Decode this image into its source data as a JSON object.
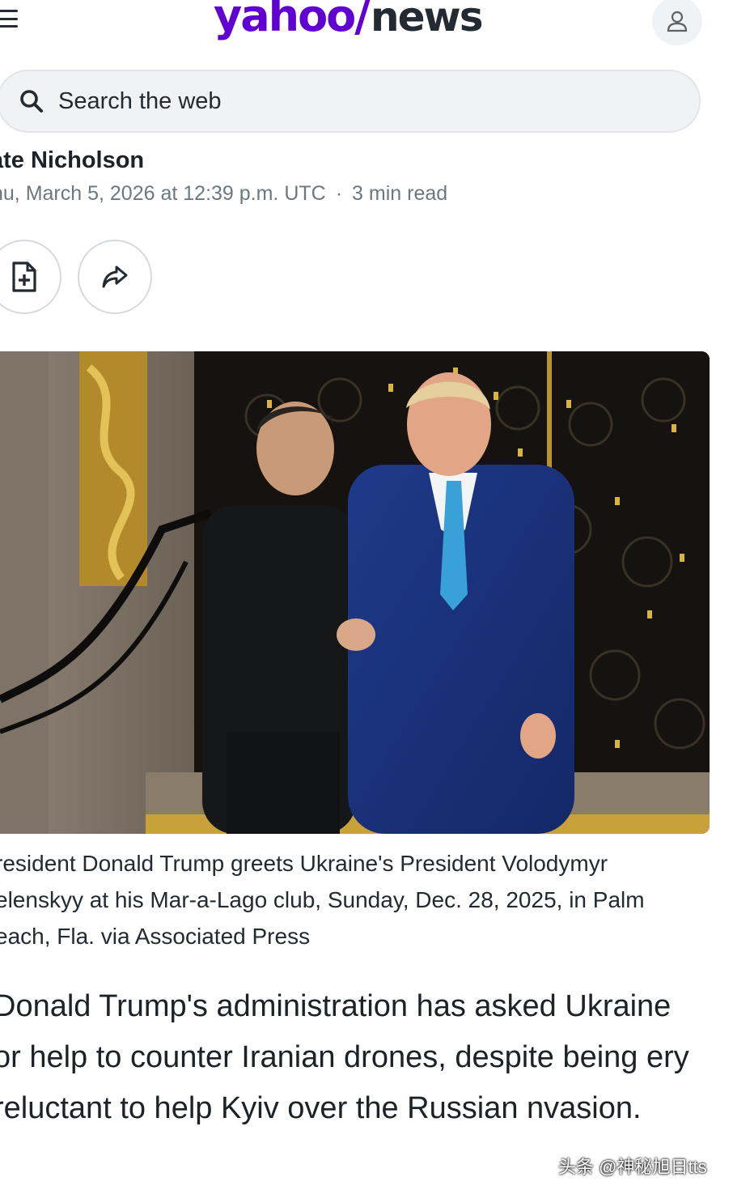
{
  "header": {
    "logo_yahoo": "yahoo/",
    "logo_news": "news",
    "menu_icon": "hamburger-menu-icon",
    "account_icon": "user-account-icon"
  },
  "search": {
    "placeholder": "Search the web",
    "icon": "search-icon"
  },
  "article": {
    "author": "ate Nicholson",
    "date": "hu, March 5, 2026 at 12:39 p.m. UTC",
    "separator": "·",
    "read_time": "3 min read",
    "actions": [
      {
        "name": "save-article",
        "icon": "add-document-icon"
      },
      {
        "name": "share",
        "icon": "share-arrow-icon"
      }
    ],
    "image_caption": "resident Donald Trump greets Ukraine's President Volodymyr elenskyy at his Mar-a-Lago club, Sunday, Dec. 28, 2025, in Palm each, Fla. via Associated Press",
    "lead_paragraph": "Donald Trump's administration has asked Ukraine or help to counter Iranian drones, despite being ery reluctant to help Kyiv over the Russian nvasion."
  },
  "watermark": "头条 @神秘旭日tts",
  "colors": {
    "brand_purple": "#6001d2",
    "text_dark": "#1d2228",
    "text_muted": "#6e7780",
    "search_bg": "#f1f2f4"
  }
}
